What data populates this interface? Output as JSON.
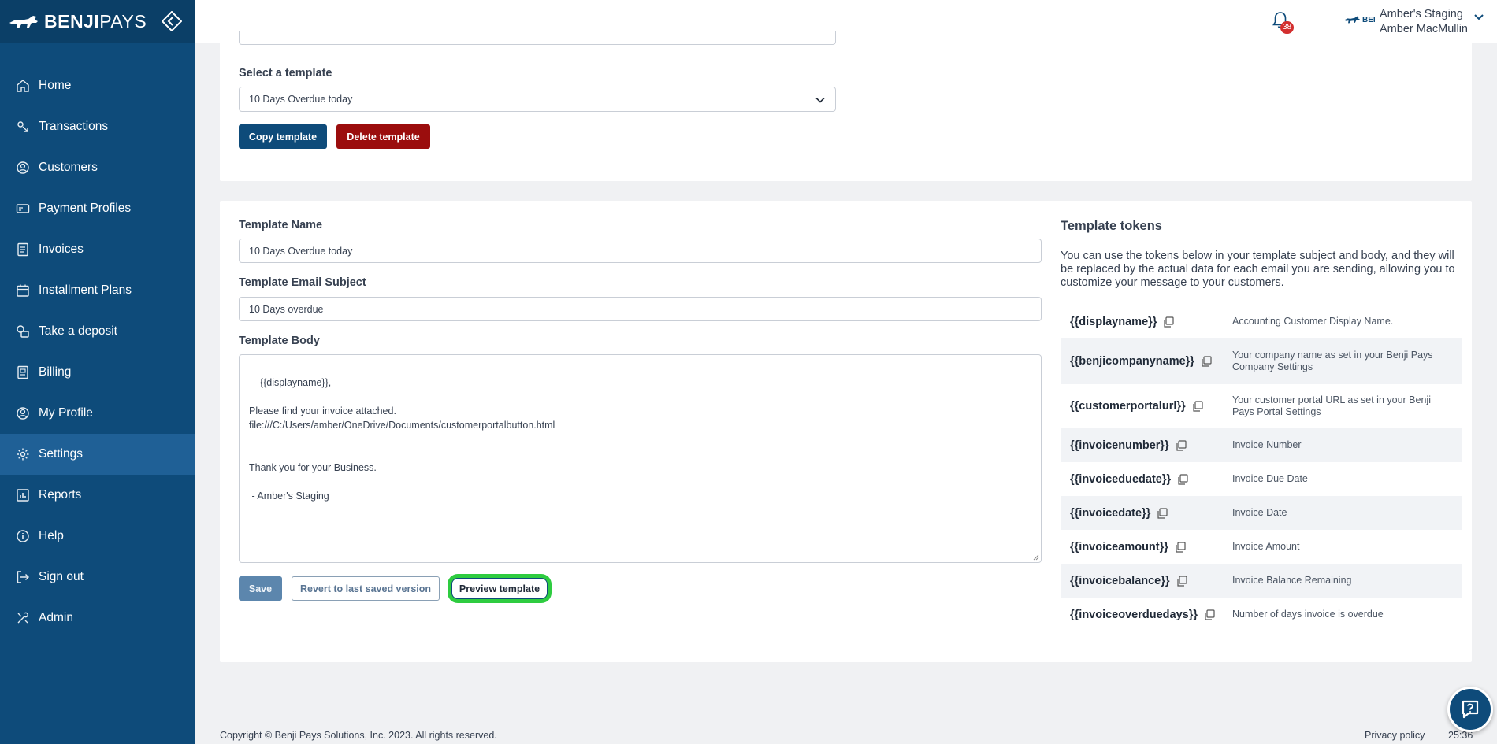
{
  "brand": {
    "name_bold": "BENJI",
    "name_light": "PAYS"
  },
  "sidebar": {
    "items": [
      {
        "label": "Home",
        "icon": "home-icon"
      },
      {
        "label": "Transactions",
        "icon": "transactions-icon"
      },
      {
        "label": "Customers",
        "icon": "customers-icon"
      },
      {
        "label": "Payment Profiles",
        "icon": "payment-profiles-icon"
      },
      {
        "label": "Invoices",
        "icon": "invoices-icon"
      },
      {
        "label": "Installment Plans",
        "icon": "calendar-icon"
      },
      {
        "label": "Take a deposit",
        "icon": "deposit-icon"
      },
      {
        "label": "Billing",
        "icon": "billing-icon"
      },
      {
        "label": "My Profile",
        "icon": "profile-icon"
      },
      {
        "label": "Settings",
        "icon": "gear-icon",
        "active": true
      },
      {
        "label": "Reports",
        "icon": "reports-icon"
      },
      {
        "label": "Help",
        "icon": "info-icon"
      },
      {
        "label": "Sign out",
        "icon": "sign-out-icon"
      },
      {
        "label": "Admin",
        "icon": "admin-tools-icon"
      }
    ]
  },
  "header": {
    "notification_count": "38",
    "account_logo_text": "BEI",
    "company": "Amber's Staging",
    "user": "Amber MacMullin"
  },
  "template_select": {
    "label": "Select a template",
    "value": "10 Days Overdue today",
    "copy_button": "Copy template",
    "delete_button": "Delete template"
  },
  "editor": {
    "name_label": "Template Name",
    "name_value": "10 Days Overdue today",
    "subject_label": "Template Email Subject",
    "subject_value": "10 Days overdue",
    "body_label": "Template Body",
    "body_value": "{{displayname}},\n\nPlease find your invoice attached.\nfile:///C:/Users/amber/OneDrive/Documents/customerportalbutton.html\n\n\nThank you for your Business.\n\n - Amber's Staging",
    "save_button": "Save",
    "revert_button": "Revert to last saved version",
    "preview_button": "Preview template"
  },
  "tokens": {
    "title": "Template tokens",
    "description": "You can use the tokens below in your template subject and body, and they will be replaced by the actual data for each email you are sending, allowing you to customize your message to your customers.",
    "rows": [
      {
        "token": "{{displayname}}",
        "desc": "Accounting Customer Display Name."
      },
      {
        "token": "{{benjicompanyname}}",
        "desc": "Your company name as set in your Benji Pays Company Settings"
      },
      {
        "token": "{{customerportalurl}}",
        "desc": "Your customer portal URL as set in your Benji Pays Portal Settings"
      },
      {
        "token": "{{invoicenumber}}",
        "desc": "Invoice Number"
      },
      {
        "token": "{{invoiceduedate}}",
        "desc": "Invoice Due Date"
      },
      {
        "token": "{{invoicedate}}",
        "desc": "Invoice Date"
      },
      {
        "token": "{{invoiceamount}}",
        "desc": "Invoice Amount"
      },
      {
        "token": "{{invoicebalance}}",
        "desc": "Invoice Balance Remaining"
      },
      {
        "token": "{{invoiceoverduedays}}",
        "desc": "Number of days invoice is overdue"
      }
    ]
  },
  "footer": {
    "copyright": "Copyright © Benji Pays Solutions, Inc. 2023. All rights reserved.",
    "privacy": "Privacy policy",
    "timer": "25:36"
  },
  "colors": {
    "sidebar": "#0e4b7a",
    "active": "#1f6096",
    "danger": "#9b0d0d",
    "highlight": "#2ecc40"
  }
}
